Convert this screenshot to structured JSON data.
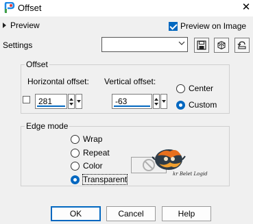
{
  "window": {
    "title": "Offset",
    "close_glyph": "✕"
  },
  "preview": {
    "label": "Preview",
    "on_image_label": "Preview on Image",
    "on_image_checked": true
  },
  "settings": {
    "label": "Settings",
    "value": ""
  },
  "offset": {
    "group_title": "Offset",
    "horizontal_label": "Horizontal offset:",
    "horizontal_value": "281",
    "vertical_label": "Vertical offset:",
    "vertical_value": "-63",
    "link_checked": false,
    "mode_options": [
      {
        "label": "Center",
        "selected": false
      },
      {
        "label": "Custom",
        "selected": true
      }
    ]
  },
  "edge_mode": {
    "group_title": "Edge mode",
    "options": [
      {
        "label": "Wrap",
        "selected": false
      },
      {
        "label": "Repeat",
        "selected": false
      },
      {
        "label": "Color",
        "selected": false
      },
      {
        "label": "Transparent",
        "selected": true
      }
    ],
    "watermark_text": "kr Belet Logid"
  },
  "buttons": {
    "ok": "OK",
    "cancel": "Cancel",
    "help": "Help"
  },
  "icons": [
    "app-logo-icon",
    "close-icon",
    "expand-triangle-icon",
    "chevron-down-icon",
    "save-preset-icon",
    "random-dice-icon",
    "reset-icon",
    "no-color-icon"
  ],
  "colors": {
    "accent": "#0067c0",
    "background": "#f0f0f0"
  }
}
